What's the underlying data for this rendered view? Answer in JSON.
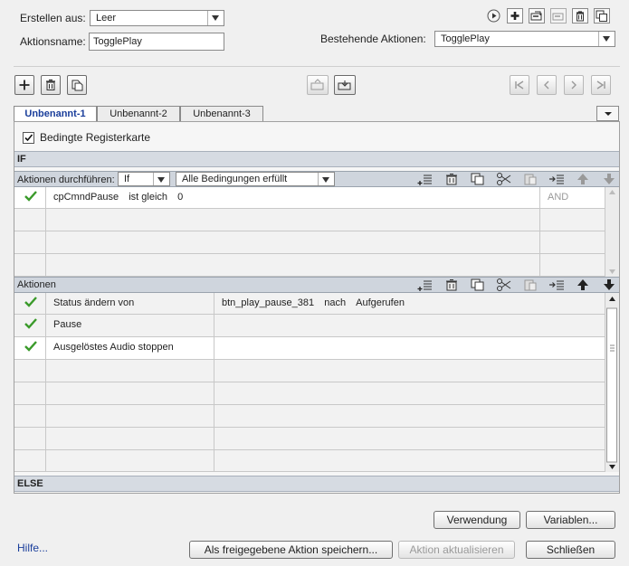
{
  "header": {
    "create_from_label": "Erstellen aus:",
    "create_from_value": "Leer",
    "action_name_label": "Aktionsname:",
    "action_name_value": "TogglePlay",
    "existing_actions_label": "Bestehende Aktionen:",
    "existing_actions_value": "TogglePlay"
  },
  "tabs": [
    {
      "label": "Unbenannt-1",
      "active": true
    },
    {
      "label": "Unbenannt-2",
      "active": false
    },
    {
      "label": "Unbenannt-3",
      "active": false
    }
  ],
  "conditional_tab": {
    "label": "Bedingte Registerkarte",
    "checked": true
  },
  "if_section": {
    "label": "IF",
    "perform_label": "Aktionen durchführen:",
    "perform_value": "If",
    "conditions_value": "Alle Bedingungen erfüllt",
    "rows": [
      {
        "variable": "cpCmndPause",
        "operator": "ist gleich",
        "value": "0",
        "conjunction": "AND",
        "checked": true
      }
    ]
  },
  "actions_section": {
    "label": "Aktionen",
    "rows": [
      {
        "action": "Status ändern von",
        "target": "btn_play_pause_381",
        "mid": "nach",
        "state": "Aufgerufen",
        "checked": true
      },
      {
        "action": "Pause",
        "target": "",
        "mid": "",
        "state": "",
        "checked": true
      },
      {
        "action": "Ausgelöstes Audio stoppen",
        "target": "",
        "mid": "",
        "state": "",
        "checked": true
      }
    ]
  },
  "else_section": {
    "label": "ELSE"
  },
  "footer": {
    "help_link": "Hilfe...",
    "usage_button": "Verwendung",
    "variables_button": "Variablen...",
    "save_shared_button": "Als freigegebene Aktion speichern...",
    "update_button": "Aktion aktualisieren",
    "close_button": "Schließen"
  },
  "colors": {
    "accent": "#1a3e9b",
    "check": "#3a9a2a",
    "section_bar": "#cfd5dd"
  }
}
